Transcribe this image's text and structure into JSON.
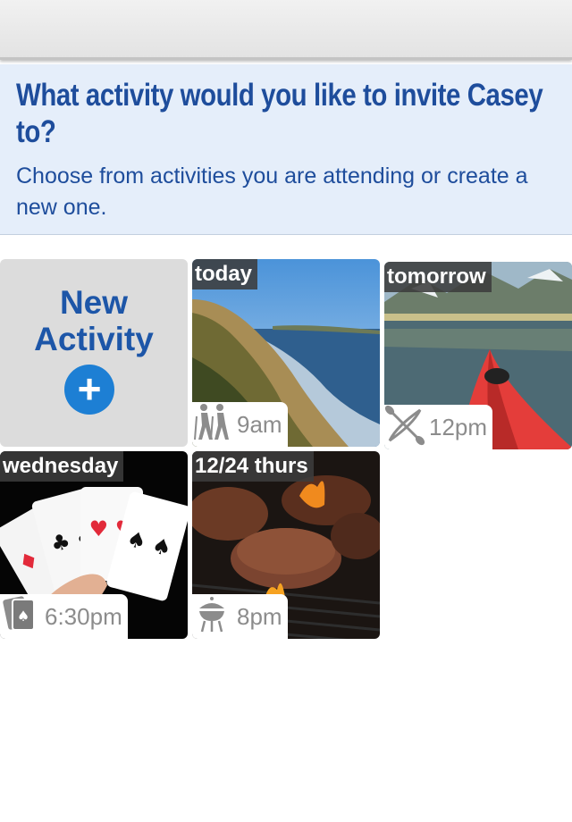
{
  "prompt": {
    "title": "What activity would you like to invite Casey to?",
    "subtitle": "Choose from activities you are attending or create a new one."
  },
  "new_activity": {
    "label": "New Activity",
    "plus": "+"
  },
  "activities": [
    {
      "day": "today",
      "time": "9am",
      "icon": "hiking-icon",
      "scene": "coastal cliffs"
    },
    {
      "day": "tomorrow",
      "time": "12pm",
      "icon": "kayak-icon",
      "scene": "red kayak on lake"
    },
    {
      "day": "wednesday",
      "time": "6:30pm",
      "icon": "playing-cards-icon",
      "scene": "hand of playing cards"
    },
    {
      "day": "12/24 thurs",
      "time": "8pm",
      "icon": "grill-icon",
      "scene": "burgers on grill"
    }
  ]
}
